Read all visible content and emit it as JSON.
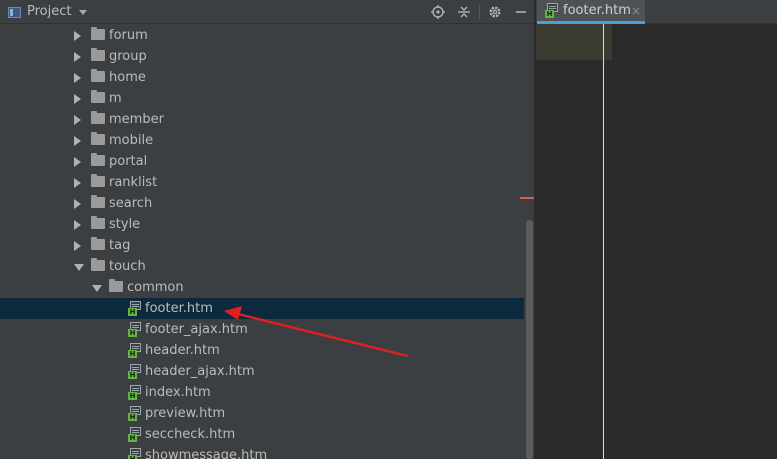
{
  "panel": {
    "title": "Project",
    "tools": [
      "target-icon",
      "collapse-icon",
      "gear-icon",
      "minimize-icon"
    ]
  },
  "tree": {
    "items": [
      {
        "label": "forum",
        "type": "folder",
        "depth": 1,
        "expanded": false
      },
      {
        "label": "group",
        "type": "folder",
        "depth": 1,
        "expanded": false
      },
      {
        "label": "home",
        "type": "folder",
        "depth": 1,
        "expanded": false
      },
      {
        "label": "m",
        "type": "folder",
        "depth": 1,
        "expanded": false
      },
      {
        "label": "member",
        "type": "folder",
        "depth": 1,
        "expanded": false
      },
      {
        "label": "mobile",
        "type": "folder",
        "depth": 1,
        "expanded": false
      },
      {
        "label": "portal",
        "type": "folder",
        "depth": 1,
        "expanded": false
      },
      {
        "label": "ranklist",
        "type": "folder",
        "depth": 1,
        "expanded": false
      },
      {
        "label": "search",
        "type": "folder",
        "depth": 1,
        "expanded": false
      },
      {
        "label": "style",
        "type": "folder",
        "depth": 1,
        "expanded": false
      },
      {
        "label": "tag",
        "type": "folder",
        "depth": 1,
        "expanded": false
      },
      {
        "label": "touch",
        "type": "folder",
        "depth": 1,
        "expanded": true
      },
      {
        "label": "common",
        "type": "folder",
        "depth": 2,
        "expanded": true
      },
      {
        "label": "footer.htm",
        "type": "file",
        "depth": 3,
        "selected": true
      },
      {
        "label": "footer_ajax.htm",
        "type": "file",
        "depth": 3
      },
      {
        "label": "header.htm",
        "type": "file",
        "depth": 3
      },
      {
        "label": "header_ajax.htm",
        "type": "file",
        "depth": 3
      },
      {
        "label": "index.htm",
        "type": "file",
        "depth": 3
      },
      {
        "label": "preview.htm",
        "type": "file",
        "depth": 3
      },
      {
        "label": "seccheck.htm",
        "type": "file",
        "depth": 3
      },
      {
        "label": "showmessage.htm",
        "type": "file",
        "depth": 3
      }
    ]
  },
  "editor": {
    "tabs": [
      {
        "label": "footer.htm",
        "close": "×",
        "active": true
      }
    ]
  },
  "colors": {
    "selection": "#0d293e",
    "annotation_arrow": "#e02020",
    "tab_underline": "#4a9fd8",
    "html_badge": "#62b543"
  }
}
